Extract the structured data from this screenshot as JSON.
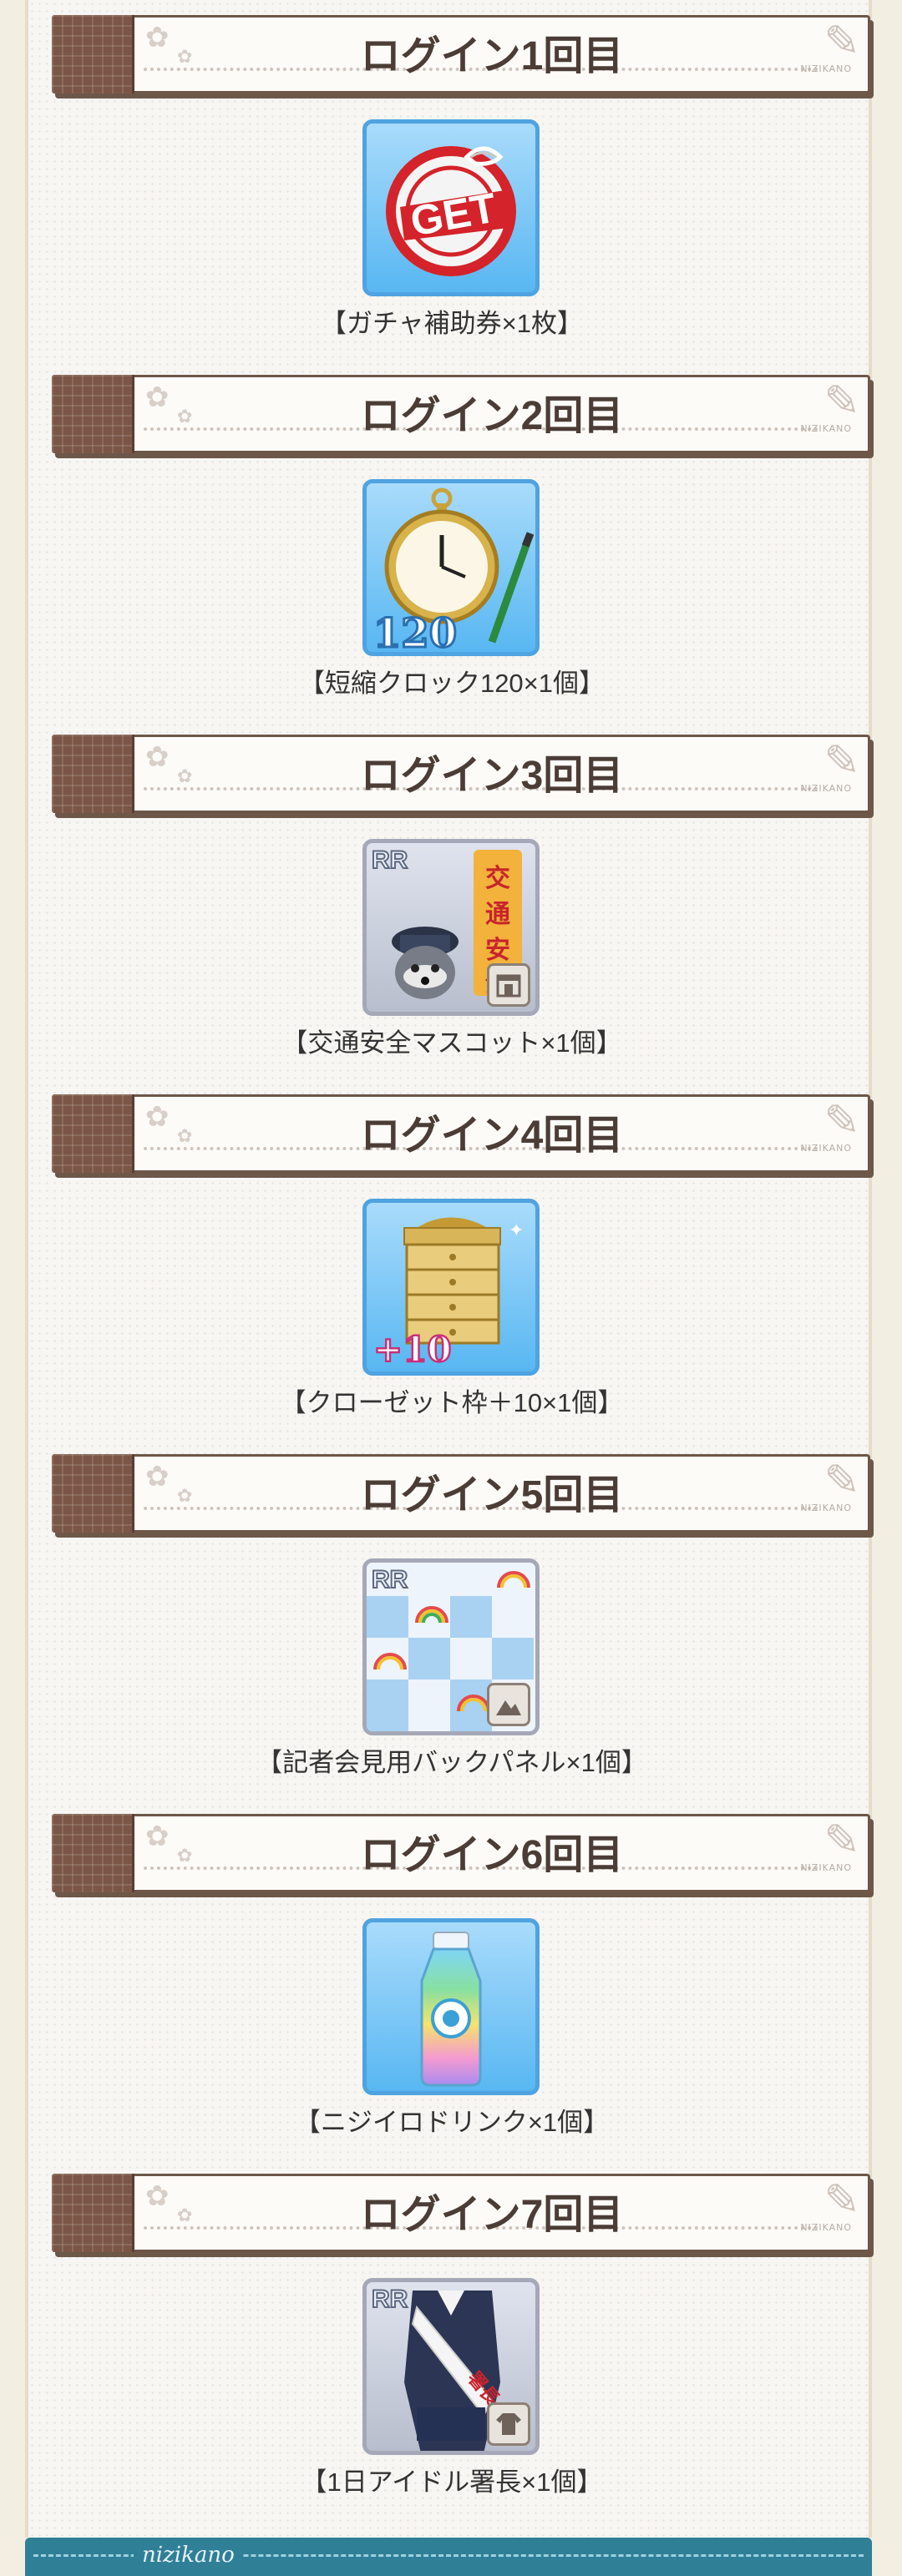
{
  "sections": [
    {
      "title": "ログイン1回目",
      "item": "【ガチャ補助券×1枚】",
      "icon": "gacha-ticket-get-icon"
    },
    {
      "title": "ログイン2回目",
      "item": "【短縮クロック120×1個】",
      "icon": "pocket-watch-icon",
      "icon_number": "120"
    },
    {
      "title": "ログイン3回目",
      "item": "【交通安全マスコット×1個】",
      "icon": "traffic-mascot-icon",
      "rarity": "RR",
      "sign_text": "交通安全"
    },
    {
      "title": "ログイン4回目",
      "item": "【クローゼット枠＋10×1個】",
      "icon": "closet-dresser-icon",
      "icon_number": "+10"
    },
    {
      "title": "ログイン5回目",
      "item": "【記者会見用バックパネル×1個】",
      "icon": "press-backpanel-icon",
      "rarity": "RR"
    },
    {
      "title": "ログイン6回目",
      "item": "【ニジイロドリンク×1個】",
      "icon": "rainbow-drink-bottle-icon"
    },
    {
      "title": "ログイン7回目",
      "item": "【1日アイドル署長×1個】",
      "icon": "idol-chief-outfit-icon",
      "rarity": "RR"
    }
  ],
  "header_brand": "NIZIKANO",
  "footer_brand": "nizikano",
  "icon_get_text": "GET",
  "colors": {
    "header_border": "#6d5749",
    "accent_blue": "#4fa3e0",
    "footer": "#2f7f97"
  }
}
